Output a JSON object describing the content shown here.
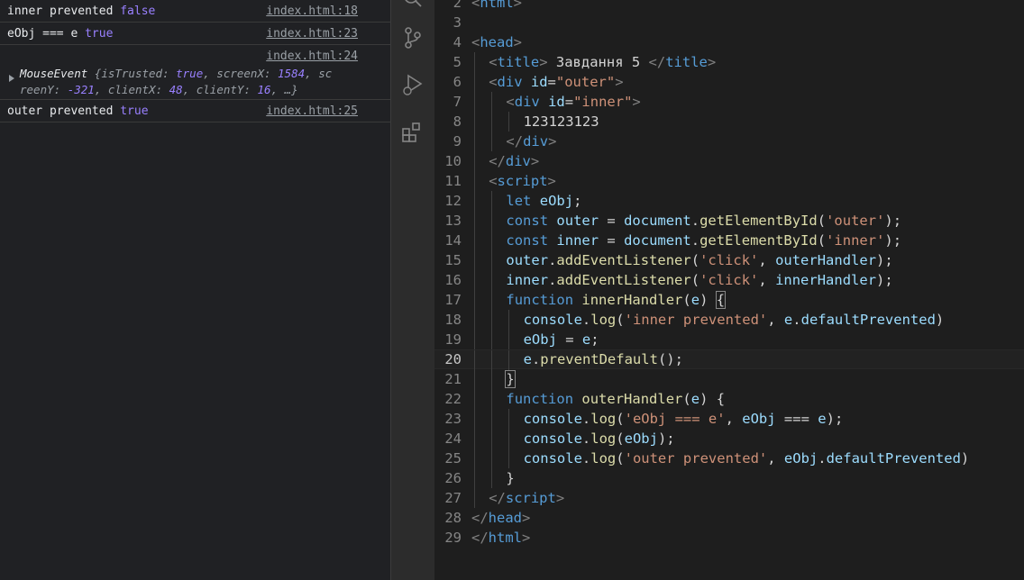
{
  "console": {
    "messages": [
      {
        "text": "inner prevented ",
        "value": "false",
        "source": "index.html:18"
      },
      {
        "text": "eObj === e ",
        "value": "true",
        "source": "index.html:23"
      },
      {
        "source": "index.html:24",
        "object_line1": [
          "MouseEvent",
          " {",
          "isTrusted",
          ": ",
          "true",
          ", ",
          "screenX",
          ": ",
          "1584",
          ", sc"
        ],
        "object_line2": [
          "reenY",
          ": ",
          "-321",
          ", ",
          "clientX",
          ": ",
          "48",
          ", ",
          "clientY",
          ": ",
          "16",
          ", …}"
        ]
      },
      {
        "text": "outer prevented ",
        "value": "true",
        "source": "index.html:25"
      }
    ]
  },
  "activity_bar": {
    "icons": [
      "search-icon",
      "source-control-icon",
      "run-debug-icon",
      "extensions-icon"
    ]
  },
  "editor": {
    "active_line": 20,
    "lines": [
      {
        "n": "2",
        "indent": 0,
        "tokens": [
          [
            "br",
            "<"
          ],
          [
            "tag",
            "html"
          ],
          [
            "br",
            ">"
          ]
        ]
      },
      {
        "n": "3",
        "indent": 0,
        "tokens": []
      },
      {
        "n": "4",
        "indent": 0,
        "tokens": [
          [
            "br",
            "<"
          ],
          [
            "tag",
            "head"
          ],
          [
            "br",
            ">"
          ]
        ]
      },
      {
        "n": "5",
        "indent": 1,
        "tokens": [
          [
            "br",
            "<"
          ],
          [
            "tag",
            "title"
          ],
          [
            "br",
            ">"
          ],
          [
            "txt",
            " Завдання 5 "
          ],
          [
            "br",
            "</"
          ],
          [
            "tag",
            "title"
          ],
          [
            "br",
            ">"
          ]
        ]
      },
      {
        "n": "6",
        "indent": 1,
        "tokens": [
          [
            "br",
            "<"
          ],
          [
            "tag",
            "div"
          ],
          [
            "txt",
            " "
          ],
          [
            "attr",
            "id"
          ],
          [
            "txt",
            "="
          ],
          [
            "str",
            "\"outer\""
          ],
          [
            "br",
            ">"
          ]
        ]
      },
      {
        "n": "7",
        "indent": 2,
        "tokens": [
          [
            "br",
            "<"
          ],
          [
            "tag",
            "div"
          ],
          [
            "txt",
            " "
          ],
          [
            "attr",
            "id"
          ],
          [
            "txt",
            "="
          ],
          [
            "str",
            "\"inner\""
          ],
          [
            "br",
            ">"
          ]
        ]
      },
      {
        "n": "8",
        "indent": 3,
        "tokens": [
          [
            "txt",
            "123123123"
          ]
        ]
      },
      {
        "n": "9",
        "indent": 2,
        "tokens": [
          [
            "br",
            "</"
          ],
          [
            "tag",
            "div"
          ],
          [
            "br",
            ">"
          ]
        ]
      },
      {
        "n": "10",
        "indent": 1,
        "tokens": [
          [
            "br",
            "</"
          ],
          [
            "tag",
            "div"
          ],
          [
            "br",
            ">"
          ]
        ]
      },
      {
        "n": "11",
        "indent": 1,
        "tokens": [
          [
            "br",
            "<"
          ],
          [
            "tag",
            "script"
          ],
          [
            "br",
            ">"
          ]
        ]
      },
      {
        "n": "12",
        "indent": 2,
        "tokens": [
          [
            "kw",
            "let"
          ],
          [
            "pn",
            " "
          ],
          [
            "var",
            "eObj"
          ],
          [
            "pn",
            ";"
          ]
        ]
      },
      {
        "n": "13",
        "indent": 2,
        "tokens": [
          [
            "kw",
            "const"
          ],
          [
            "pn",
            " "
          ],
          [
            "var",
            "outer"
          ],
          [
            "pn",
            " = "
          ],
          [
            "var",
            "document"
          ],
          [
            "pn",
            "."
          ],
          [
            "fn",
            "getElementById"
          ],
          [
            "pn",
            "("
          ],
          [
            "str",
            "'outer'"
          ],
          [
            "pn",
            ");"
          ]
        ]
      },
      {
        "n": "14",
        "indent": 2,
        "tokens": [
          [
            "kw",
            "const"
          ],
          [
            "pn",
            " "
          ],
          [
            "var",
            "inner"
          ],
          [
            "pn",
            " = "
          ],
          [
            "var",
            "document"
          ],
          [
            "pn",
            "."
          ],
          [
            "fn",
            "getElementById"
          ],
          [
            "pn",
            "("
          ],
          [
            "str",
            "'inner'"
          ],
          [
            "pn",
            ");"
          ]
        ]
      },
      {
        "n": "15",
        "indent": 2,
        "tokens": [
          [
            "var",
            "outer"
          ],
          [
            "pn",
            "."
          ],
          [
            "fn",
            "addEventListener"
          ],
          [
            "pn",
            "("
          ],
          [
            "str",
            "'click'"
          ],
          [
            "pn",
            ", "
          ],
          [
            "var",
            "outerHandler"
          ],
          [
            "pn",
            ");"
          ]
        ]
      },
      {
        "n": "16",
        "indent": 2,
        "tokens": [
          [
            "var",
            "inner"
          ],
          [
            "pn",
            "."
          ],
          [
            "fn",
            "addEventListener"
          ],
          [
            "pn",
            "("
          ],
          [
            "str",
            "'click'"
          ],
          [
            "pn",
            ", "
          ],
          [
            "var",
            "innerHandler"
          ],
          [
            "pn",
            ");"
          ]
        ]
      },
      {
        "n": "17",
        "indent": 2,
        "tokens": [
          [
            "kw",
            "function"
          ],
          [
            "pn",
            " "
          ],
          [
            "fn",
            "innerHandler"
          ],
          [
            "pn",
            "("
          ],
          [
            "var",
            "e"
          ],
          [
            "pn",
            ") "
          ],
          [
            "hl",
            "{"
          ]
        ]
      },
      {
        "n": "18",
        "indent": 3,
        "tokens": [
          [
            "var",
            "console"
          ],
          [
            "pn",
            "."
          ],
          [
            "fn",
            "log"
          ],
          [
            "pn",
            "("
          ],
          [
            "str",
            "'inner prevented'"
          ],
          [
            "pn",
            ", "
          ],
          [
            "var",
            "e"
          ],
          [
            "pn",
            "."
          ],
          [
            "var",
            "defaultPrevented"
          ],
          [
            "pn",
            ")"
          ]
        ]
      },
      {
        "n": "19",
        "indent": 3,
        "tokens": [
          [
            "var",
            "eObj"
          ],
          [
            "pn",
            " = "
          ],
          [
            "var",
            "e"
          ],
          [
            "pn",
            ";"
          ]
        ]
      },
      {
        "n": "20",
        "indent": 3,
        "tokens": [
          [
            "var",
            "e"
          ],
          [
            "pn",
            "."
          ],
          [
            "fn",
            "preventDefault"
          ],
          [
            "pn",
            "();"
          ]
        ]
      },
      {
        "n": "21",
        "indent": 2,
        "tokens": [
          [
            "hl",
            "}"
          ]
        ]
      },
      {
        "n": "22",
        "indent": 2,
        "tokens": [
          [
            "kw",
            "function"
          ],
          [
            "pn",
            " "
          ],
          [
            "fn",
            "outerHandler"
          ],
          [
            "pn",
            "("
          ],
          [
            "var",
            "e"
          ],
          [
            "pn",
            ") {"
          ]
        ]
      },
      {
        "n": "23",
        "indent": 3,
        "tokens": [
          [
            "var",
            "console"
          ],
          [
            "pn",
            "."
          ],
          [
            "fn",
            "log"
          ],
          [
            "pn",
            "("
          ],
          [
            "str",
            "'eObj === e'"
          ],
          [
            "pn",
            ", "
          ],
          [
            "var",
            "eObj"
          ],
          [
            "pn",
            " === "
          ],
          [
            "var",
            "e"
          ],
          [
            "pn",
            ");"
          ]
        ]
      },
      {
        "n": "24",
        "indent": 3,
        "tokens": [
          [
            "var",
            "console"
          ],
          [
            "pn",
            "."
          ],
          [
            "fn",
            "log"
          ],
          [
            "pn",
            "("
          ],
          [
            "var",
            "eObj"
          ],
          [
            "pn",
            ");"
          ]
        ]
      },
      {
        "n": "25",
        "indent": 3,
        "tokens": [
          [
            "var",
            "console"
          ],
          [
            "pn",
            "."
          ],
          [
            "fn",
            "log"
          ],
          [
            "pn",
            "("
          ],
          [
            "str",
            "'outer prevented'"
          ],
          [
            "pn",
            ", "
          ],
          [
            "var",
            "eObj"
          ],
          [
            "pn",
            "."
          ],
          [
            "var",
            "defaultPrevented"
          ],
          [
            "pn",
            ")"
          ]
        ]
      },
      {
        "n": "26",
        "indent": 2,
        "tokens": [
          [
            "pn",
            "}"
          ]
        ]
      },
      {
        "n": "27",
        "indent": 1,
        "tokens": [
          [
            "br",
            "</"
          ],
          [
            "tag",
            "script"
          ],
          [
            "br",
            ">"
          ]
        ]
      },
      {
        "n": "28",
        "indent": 0,
        "tokens": [
          [
            "br",
            "</"
          ],
          [
            "tag",
            "head"
          ],
          [
            "br",
            ">"
          ]
        ]
      },
      {
        "n": "29",
        "indent": 0,
        "tokens": [
          [
            "br",
            "</"
          ],
          [
            "tag",
            "html"
          ],
          [
            "br",
            ">"
          ]
        ]
      }
    ]
  },
  "colors": {
    "console_bg": "#202124",
    "editor_bg": "#1e1e1e",
    "activity_bg": "#2c2c2c",
    "keyword": "#569cd6",
    "string": "#ce9178",
    "function": "#dcdcaa",
    "variable": "#9cdcfe",
    "boolean": "#9980ff"
  }
}
